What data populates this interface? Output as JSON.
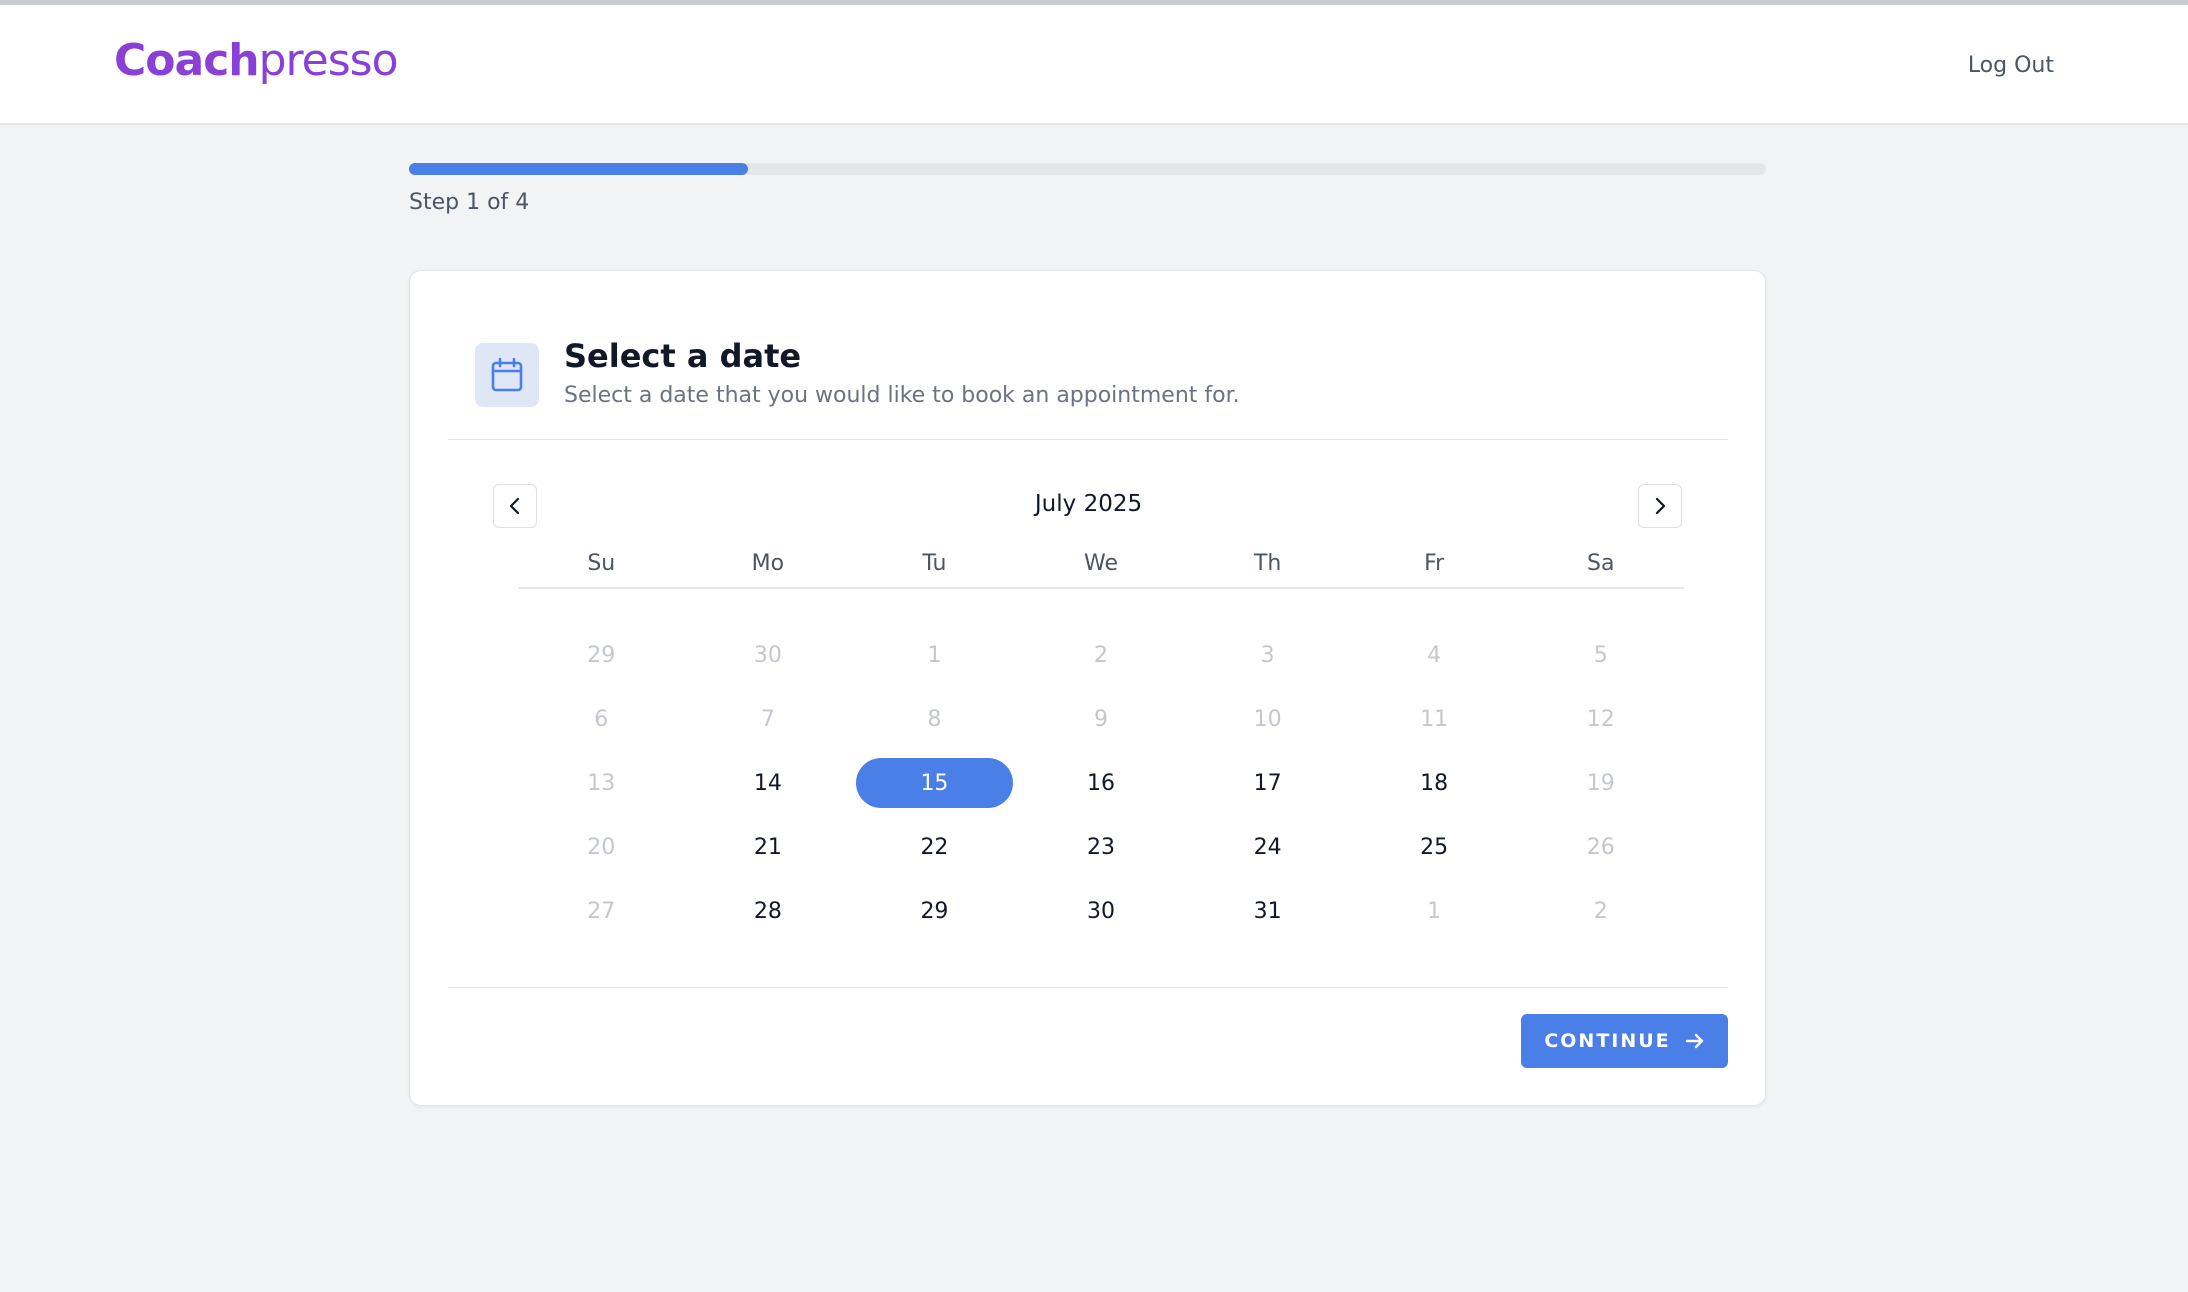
{
  "header": {
    "logo_part1": "Coach",
    "logo_part2": "presso",
    "logout_label": "Log Out"
  },
  "progress": {
    "label": "Step 1 of 4",
    "fraction": 0.25
  },
  "card": {
    "title": "Select a date",
    "subtitle": "Select a date that you would like to book an appointment for.",
    "icon": "calendar-icon"
  },
  "calendar": {
    "month_label": "July 2025",
    "weekdays": [
      "Su",
      "Mo",
      "Tu",
      "We",
      "Th",
      "Fr",
      "Sa"
    ],
    "weeks": [
      [
        {
          "d": "29",
          "s": "muted"
        },
        {
          "d": "30",
          "s": "muted"
        },
        {
          "d": "1",
          "s": "muted"
        },
        {
          "d": "2",
          "s": "muted"
        },
        {
          "d": "3",
          "s": "muted"
        },
        {
          "d": "4",
          "s": "muted"
        },
        {
          "d": "5",
          "s": "muted"
        }
      ],
      [
        {
          "d": "6",
          "s": "muted"
        },
        {
          "d": "7",
          "s": "muted"
        },
        {
          "d": "8",
          "s": "muted"
        },
        {
          "d": "9",
          "s": "muted"
        },
        {
          "d": "10",
          "s": "muted"
        },
        {
          "d": "11",
          "s": "muted"
        },
        {
          "d": "12",
          "s": "muted"
        }
      ],
      [
        {
          "d": "13",
          "s": "muted"
        },
        {
          "d": "14",
          "s": "active"
        },
        {
          "d": "15",
          "s": "selected"
        },
        {
          "d": "16",
          "s": "active"
        },
        {
          "d": "17",
          "s": "active"
        },
        {
          "d": "18",
          "s": "active"
        },
        {
          "d": "19",
          "s": "muted"
        }
      ],
      [
        {
          "d": "20",
          "s": "muted"
        },
        {
          "d": "21",
          "s": "active"
        },
        {
          "d": "22",
          "s": "active"
        },
        {
          "d": "23",
          "s": "active"
        },
        {
          "d": "24",
          "s": "active"
        },
        {
          "d": "25",
          "s": "active"
        },
        {
          "d": "26",
          "s": "muted"
        }
      ],
      [
        {
          "d": "27",
          "s": "muted"
        },
        {
          "d": "28",
          "s": "active"
        },
        {
          "d": "29",
          "s": "active"
        },
        {
          "d": "30",
          "s": "active"
        },
        {
          "d": "31",
          "s": "active"
        },
        {
          "d": "1",
          "s": "muted"
        },
        {
          "d": "2",
          "s": "muted"
        }
      ]
    ]
  },
  "actions": {
    "continue_label": "CONTINUE"
  },
  "colors": {
    "accent": "#4a7fe8",
    "logo": "#8a3fd6",
    "background": "#f2f3f5"
  }
}
